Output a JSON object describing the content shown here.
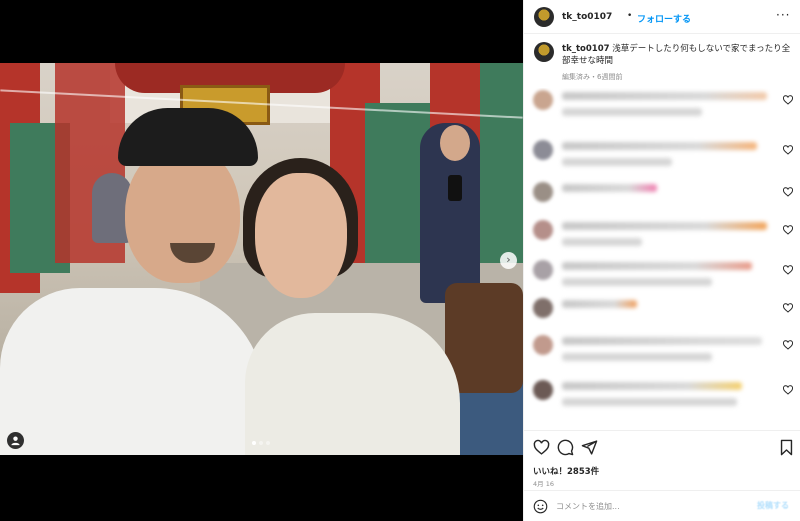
{
  "post": {
    "username": "tk_to0107",
    "separator": "•",
    "follow_label": "フォローする",
    "more_label": "···",
    "caption_user": "tk_to0107",
    "caption_text": "浅草デートしたり何もしないで家でまったり全部幸せな時間",
    "caption_meta": "編集済み・6週間前",
    "likes_label": "いいね！2853件",
    "date_label": "4月 16",
    "comment_placeholder": "コメントを追加...",
    "post_label": "投稿する",
    "next_arrow": "›",
    "carousel": {
      "count": 3,
      "active_index": 0
    }
  },
  "colors": {
    "accent": "#0095f6",
    "text": "#262626",
    "muted": "#8e8e8e"
  },
  "icons": {
    "header_more": "more-icon",
    "like": "heart-icon",
    "comment": "comment-icon",
    "share": "share-icon",
    "save": "bookmark-icon",
    "emoji": "emoji-icon",
    "tag": "user-tag-icon",
    "next": "chevron-right-icon"
  }
}
